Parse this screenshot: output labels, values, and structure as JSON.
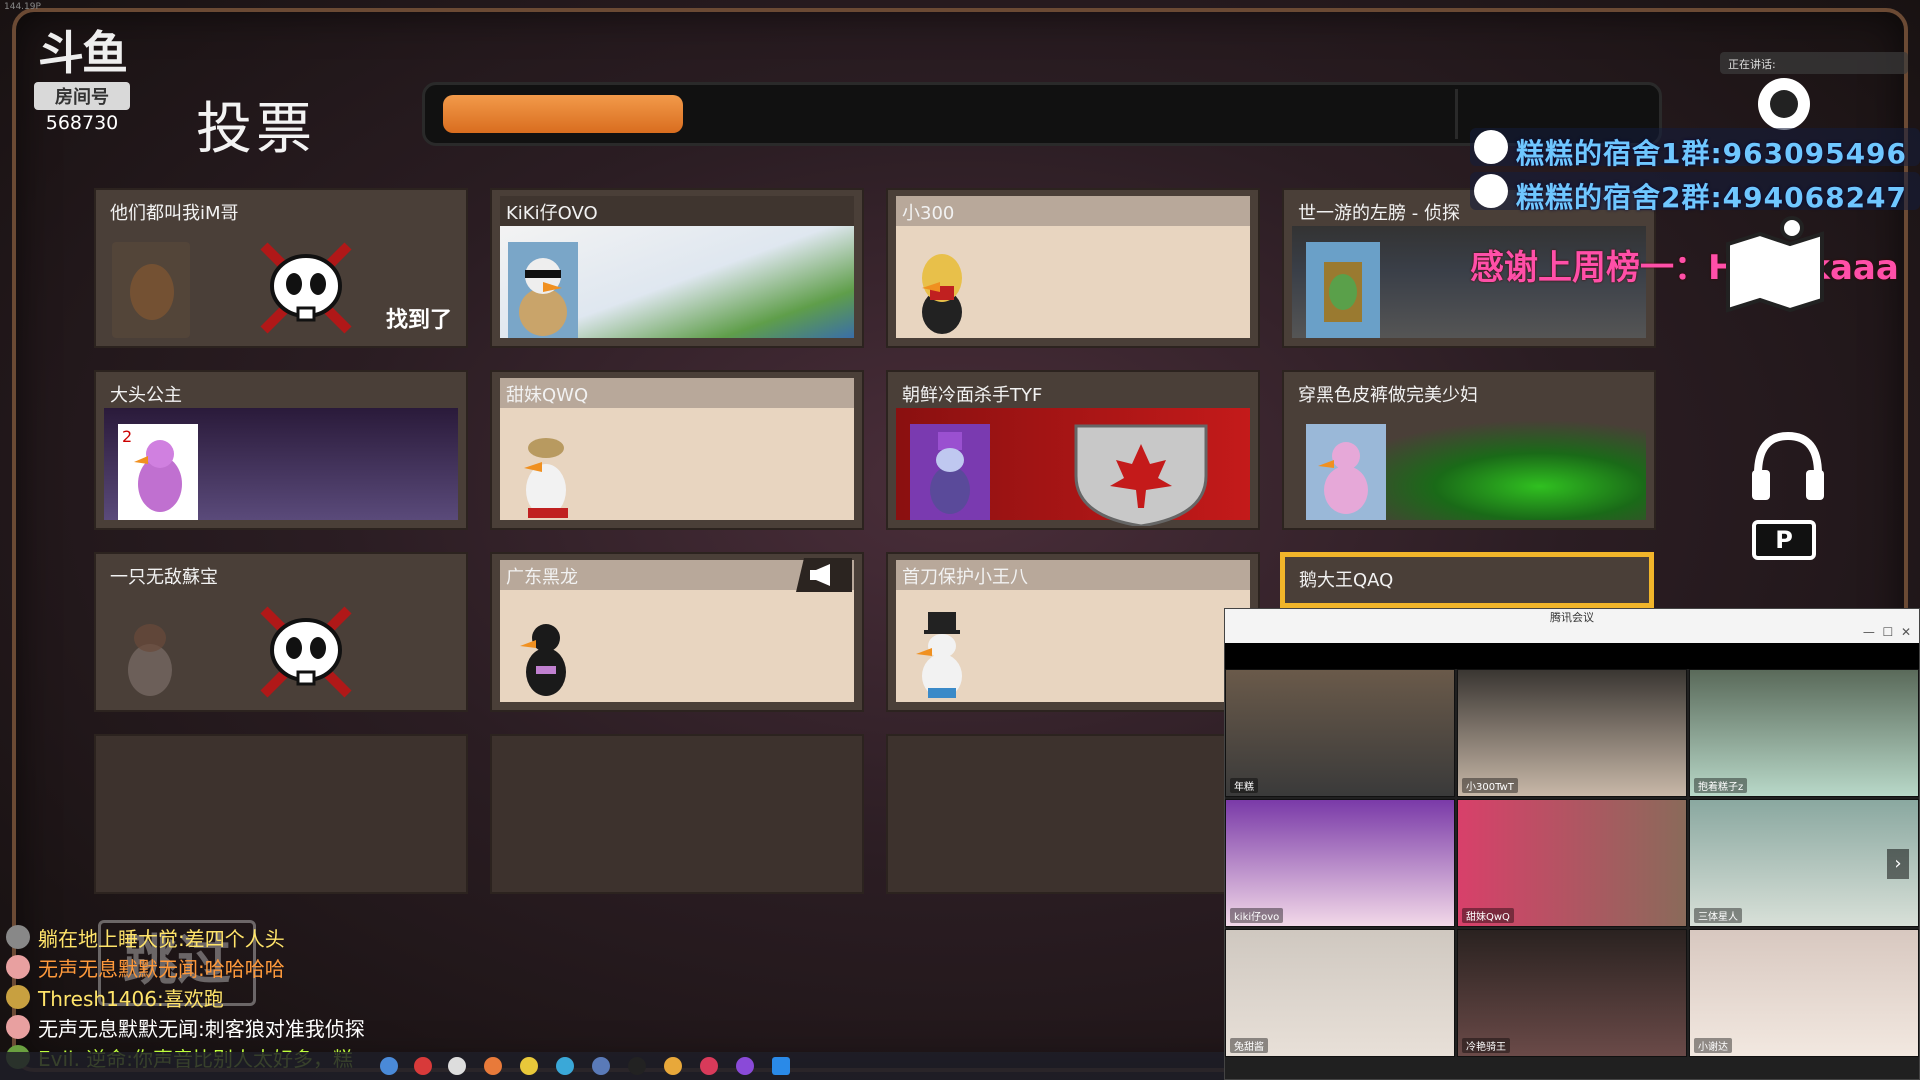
{
  "corner_text": "144.19P",
  "logo": {
    "mark": "斗鱼",
    "room_label": "房间号",
    "room_id": "568730"
  },
  "vote": {
    "title": "投票",
    "progress": 0.2
  },
  "players": [
    {
      "name": "他们都叫我iM哥",
      "status": "dead",
      "note": "找到了"
    },
    {
      "name": "KiKi仔OVO",
      "status": "alive"
    },
    {
      "name": "小300",
      "status": "alive"
    },
    {
      "name": "世一游的左膀 - 侦探",
      "status": "alive"
    },
    {
      "name": "大头公主",
      "status": "alive"
    },
    {
      "name": "甜妹QWQ",
      "status": "alive"
    },
    {
      "name": "朝鲜冷面杀手TYF",
      "status": "alive"
    },
    {
      "name": "穿黑色皮裤做完美少妇",
      "status": "alive"
    },
    {
      "name": "一只无敌蘇宝",
      "status": "dead"
    },
    {
      "name": "广东黑龙",
      "status": "alive",
      "speaking": true
    },
    {
      "name": "首刀保护小王八",
      "status": "alive"
    },
    {
      "name": "鹅大王QAQ",
      "status": "alive",
      "highlight": true
    }
  ],
  "overlay": {
    "group1": "糕糕的宿舍1群:963095496",
    "group2": "糕糕的宿舍2群:494068247",
    "thanks": "感谢上周榜一：Honokaaa",
    "speaking": "正在讲话:"
  },
  "controls": {
    "key": "P"
  },
  "meeting": {
    "title": "腾讯会议",
    "participants": [
      "年糕",
      "小300TwT",
      "抱着糕子z",
      "kiki仔ovo",
      "甜妹QwQ",
      "三体星人",
      "兔甜酱",
      "冷艳骑王",
      "小谢达"
    ]
  },
  "chat": [
    {
      "text": "躺在地上睡大觉:差四个人头",
      "color": "#ffe46a"
    },
    {
      "text": "无声无息默默无闻:哈哈哈哈",
      "color": "#ff9a3c"
    },
    {
      "text": "Thresh1406:喜欢跑",
      "color": "#ffe46a"
    },
    {
      "text": "无声无息默默无闻:刺客狼对准我侦探",
      "color": "#ffffff"
    },
    {
      "text": "Evil. 逆命:你声音比别人太好多，糕",
      "color": "#bfff3c"
    }
  ],
  "skip_label": "跳过",
  "colors": {
    "accent": "#e8802c",
    "highlight": "#f1b52a",
    "qq_text": "#6fc7ff",
    "thanks": "#ff4fa8"
  }
}
